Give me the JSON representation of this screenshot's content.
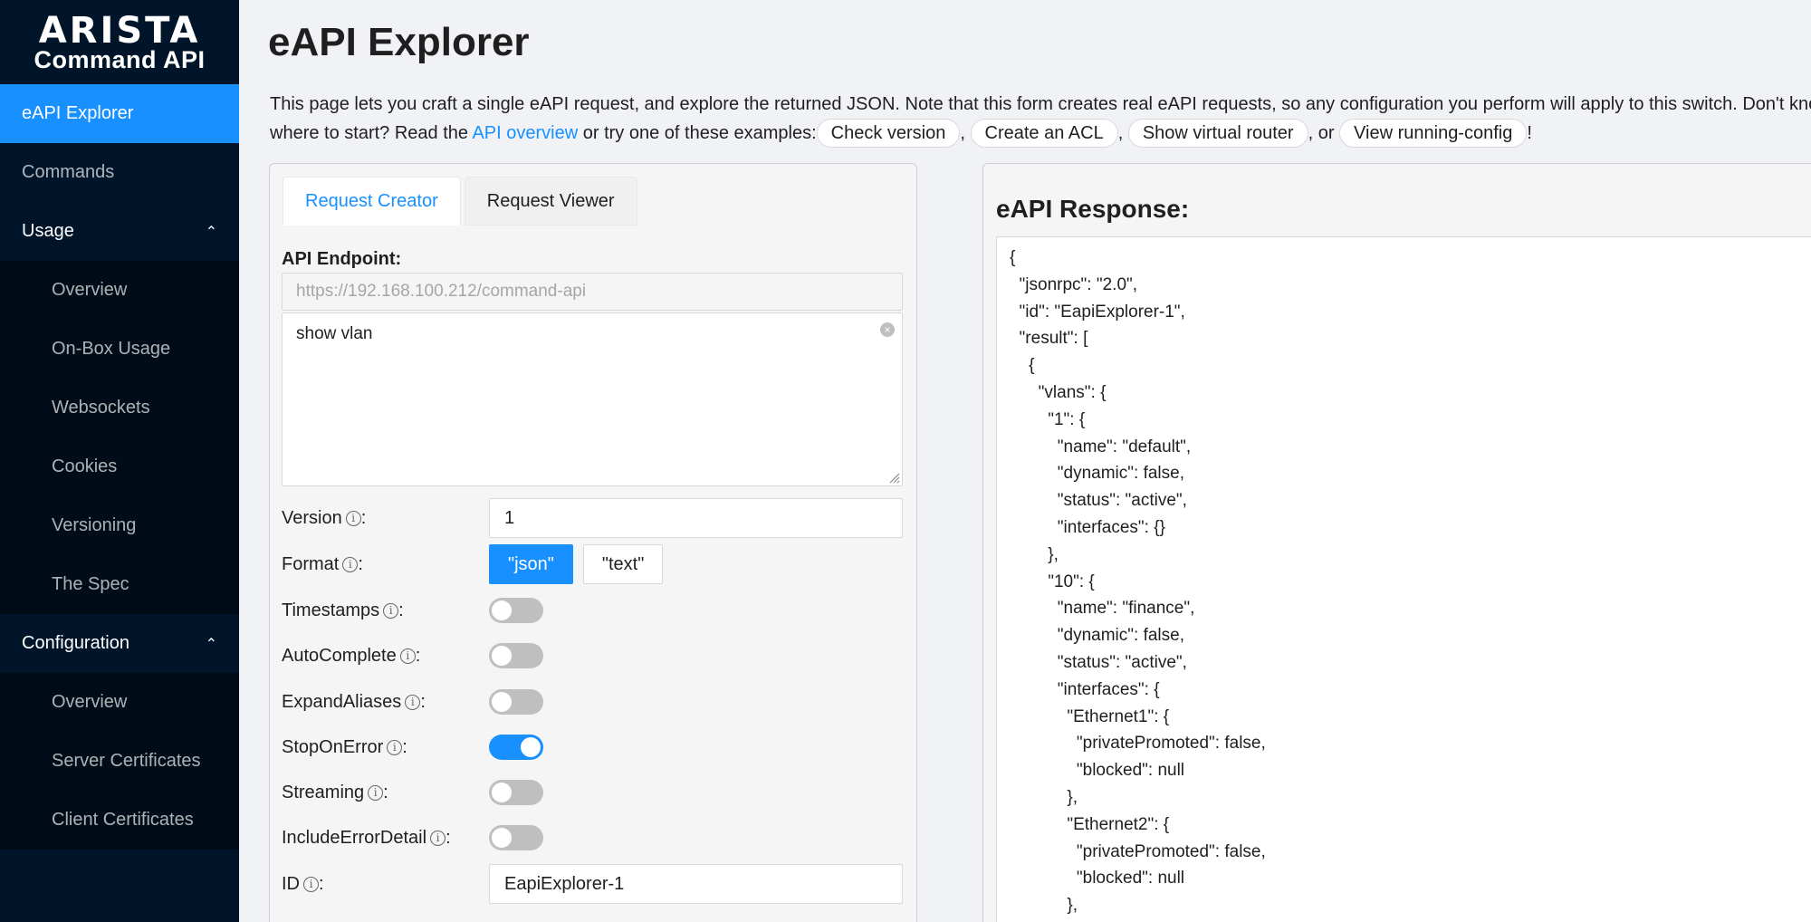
{
  "sidebar": {
    "logo_brand": "ARISTA",
    "logo_sub": "Command API",
    "items": [
      {
        "label": "eAPI Explorer"
      },
      {
        "label": "Commands"
      }
    ],
    "usage": {
      "label": "Usage",
      "items": [
        "Overview",
        "On-Box Usage",
        "Websockets",
        "Cookies",
        "Versioning",
        "The Spec"
      ]
    },
    "configuration": {
      "label": "Configuration",
      "items": [
        "Overview",
        "Server Certificates",
        "Client Certificates"
      ]
    }
  },
  "page": {
    "title": "eAPI Explorer",
    "intro_line1": "This page lets you craft a single eAPI request, and explore the returned JSON. Note that this form creates real eAPI requests, so any configuration you perform will apply to this switch. Don't know",
    "intro_line2_a": "where to start? Read the ",
    "intro_link": "API overview",
    "intro_line2_b": " or try one of these examples:",
    "examples": [
      "Check version",
      "Create an ACL",
      "Show virtual router",
      "View running-config"
    ],
    "sep_comma": ",",
    "sep_or": ", or",
    "end_mark": "!"
  },
  "request": {
    "tabs": [
      "Request Creator",
      "Request Viewer"
    ],
    "endpoint_label": "API Endpoint:",
    "endpoint_placeholder": "https://192.168.100.212/command-api",
    "command_value": "show vlan",
    "version_label": "Version",
    "version_value": "1",
    "format_label": "Format",
    "format_options": [
      "\"json\"",
      "\"text\""
    ],
    "format_selected": "\"json\"",
    "toggles": [
      {
        "label": "Timestamps",
        "on": false
      },
      {
        "label": "AutoComplete",
        "on": false
      },
      {
        "label": "ExpandAliases",
        "on": false
      },
      {
        "label": "StopOnError",
        "on": true
      },
      {
        "label": "Streaming",
        "on": false
      },
      {
        "label": "IncludeErrorDetail",
        "on": false
      }
    ],
    "id_label": "ID",
    "id_value": "EapiExplorer-1",
    "colon": ":",
    "info_glyph": "i"
  },
  "response": {
    "title": "eAPI Response:",
    "body": "{\n  \"jsonrpc\": \"2.0\",\n  \"id\": \"EapiExplorer-1\",\n  \"result\": [\n    {\n      \"vlans\": {\n        \"1\": {\n          \"name\": \"default\",\n          \"dynamic\": false,\n          \"status\": \"active\",\n          \"interfaces\": {}\n        },\n        \"10\": {\n          \"name\": \"finance\",\n          \"dynamic\": false,\n          \"status\": \"active\",\n          \"interfaces\": {\n            \"Ethernet1\": {\n              \"privatePromoted\": false,\n              \"blocked\": null\n            },\n            \"Ethernet2\": {\n              \"privatePromoted\": false,\n              \"blocked\": null\n            },"
  },
  "colors": {
    "sidebar_bg": "#001529",
    "accent": "#1890ff"
  }
}
